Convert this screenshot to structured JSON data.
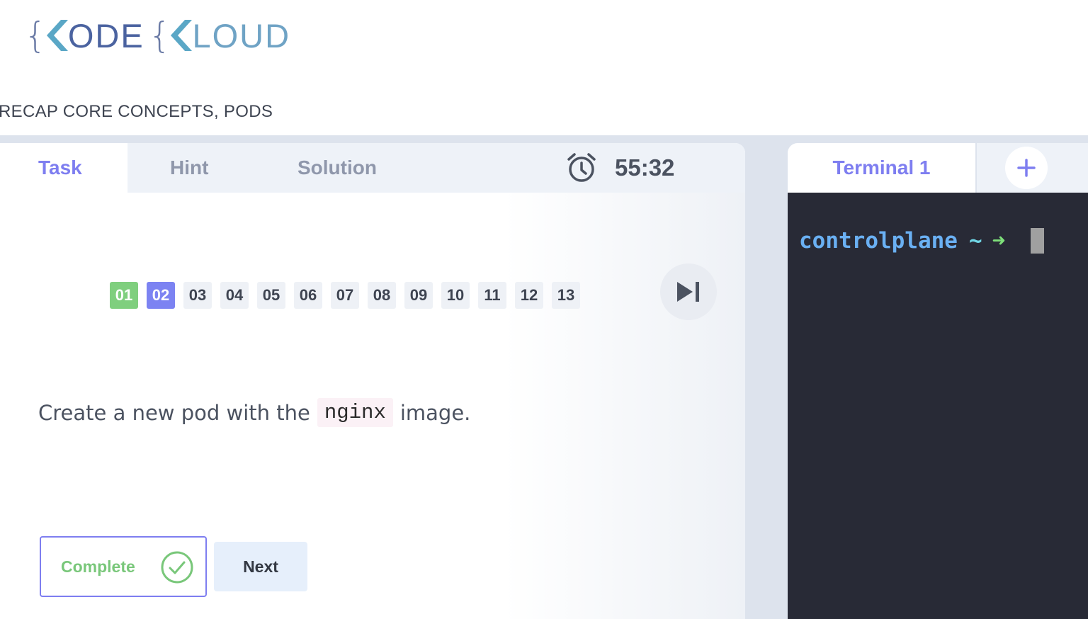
{
  "logo": {
    "word1": "ODE",
    "word2": "LOUD"
  },
  "breadcrumb": "RECAP CORE CONCEPTS, PODS",
  "tabs": {
    "task": "Task",
    "hint": "Hint",
    "solution": "Solution"
  },
  "timer": {
    "value": "55:32"
  },
  "steps": [
    "01",
    "02",
    "03",
    "04",
    "05",
    "06",
    "07",
    "08",
    "09",
    "10",
    "11",
    "12",
    "13"
  ],
  "question": {
    "before": "Create a new pod with the",
    "code": "nginx",
    "after": "image."
  },
  "buttons": {
    "complete": "Complete",
    "next": "Next"
  },
  "terminal": {
    "tab_label": "Terminal 1",
    "host": "controlplane",
    "tilde": "~",
    "arrow": "➜"
  },
  "colors": {
    "accent": "#7e7ef0",
    "done": "#7fcf7e",
    "terminal_bg": "#282a36"
  }
}
